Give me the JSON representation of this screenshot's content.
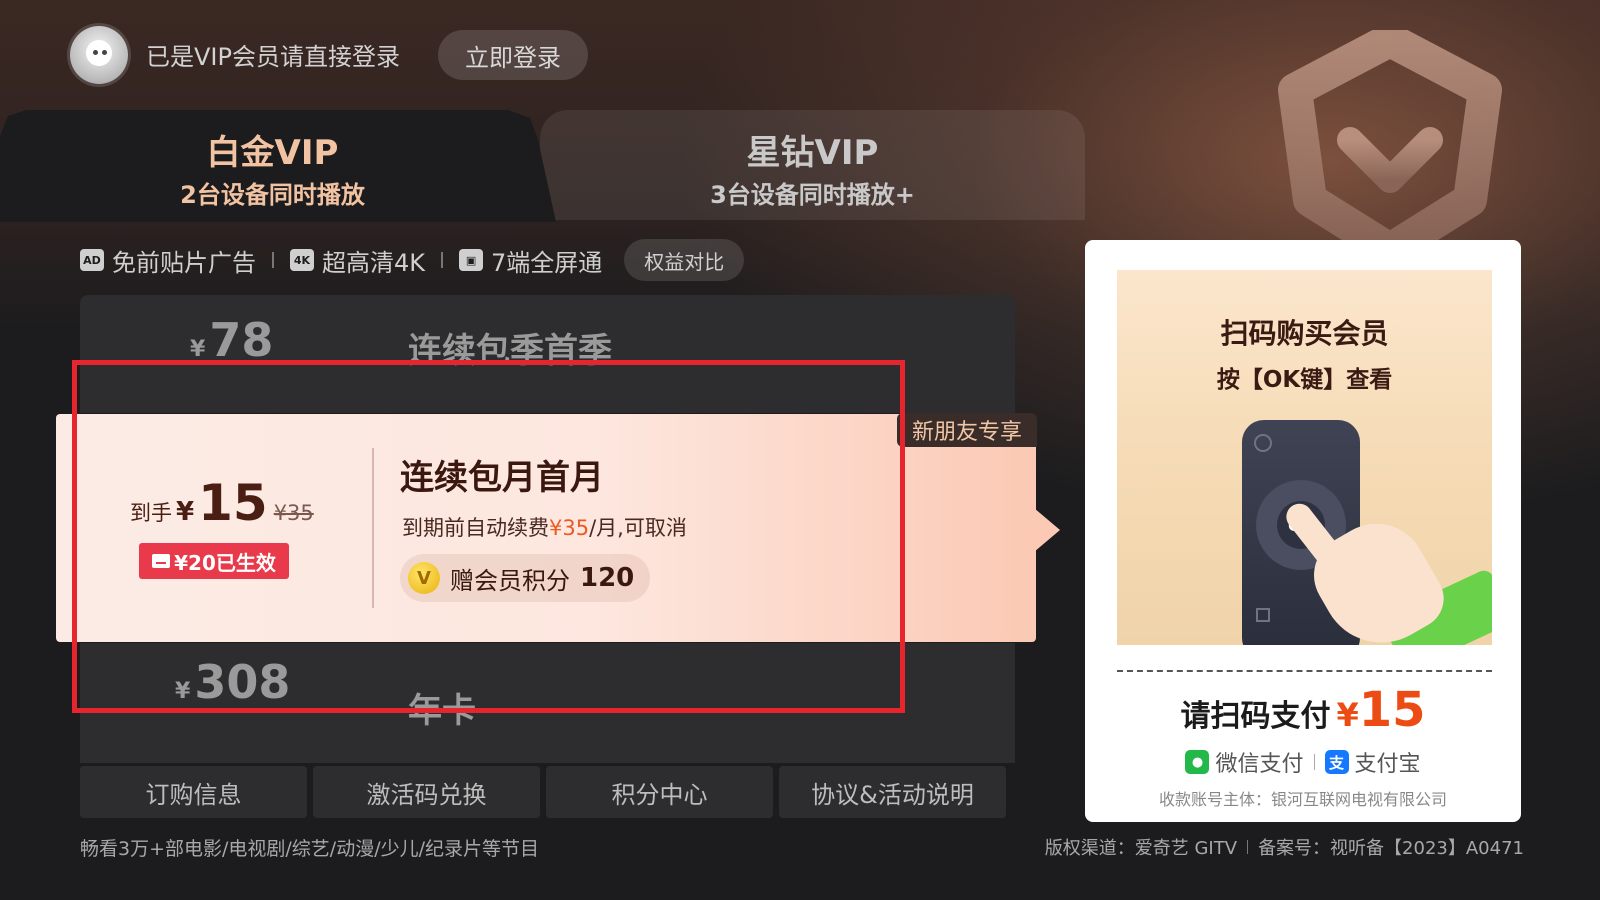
{
  "header": {
    "login_hint": "已是VIP会员请直接登录",
    "login_button": "立即登录"
  },
  "tabs": [
    {
      "title": "白金VIP",
      "subtitle": "2台设备同时播放",
      "active": true
    },
    {
      "title": "星钻VIP",
      "subtitle": "3台设备同时播放+",
      "active": false
    }
  ],
  "features": [
    {
      "icon": "ad-free-icon",
      "glyph": "AD",
      "label": "免前贴片广告"
    },
    {
      "icon": "4k-icon",
      "glyph": "4K",
      "label": "超高清4K"
    },
    {
      "icon": "devices-icon",
      "glyph": "▣",
      "label": "7端全屏通"
    }
  ],
  "compare_button": "权益对比",
  "plans": [
    {
      "yen": "¥",
      "price": "78",
      "name": "连续包季首季"
    },
    {
      "selected": true,
      "prefix": "到手",
      "yen": "¥",
      "price": "15",
      "original": "¥35",
      "coupon": "¥20已生效",
      "badge": "新朋友专享",
      "name": "连续包月首月",
      "desc_before": "到期前自动续费",
      "desc_highlight": "¥35",
      "desc_after": "/月,可取消",
      "points_label": "赠会员积分",
      "points_value": "120"
    },
    {
      "yen": "¥",
      "price": "308",
      "name": "年卡"
    }
  ],
  "bottom_buttons": [
    "订购信息",
    "激活码兑换",
    "积分中心",
    "协议&活动说明"
  ],
  "footer": {
    "left": "畅看3万+部电影/电视剧/综艺/动漫/少儿/纪录片等节目",
    "copyright": "版权渠道：爱奇艺 GITV",
    "license": "备案号：视听备【2023】A0471"
  },
  "qr_panel": {
    "title": "扫码购买会员",
    "subtitle": "按【OK键】查看",
    "ok_label": "OK",
    "pay_label": "请扫码支付",
    "pay_yen": "¥",
    "pay_amount": "15",
    "wechat": "微信支付",
    "alipay": "支付宝",
    "alipay_glyph": "支",
    "payee": "收款账号主体：银河互联网电视有限公司"
  },
  "colors": {
    "accent_gold": "#f2c3a2",
    "price_orange": "#ec4b14",
    "coupon_red": "#e83a4a",
    "highlight_border": "#e8242f",
    "wechat_green": "#22b84a",
    "alipay_blue": "#1677ff"
  }
}
